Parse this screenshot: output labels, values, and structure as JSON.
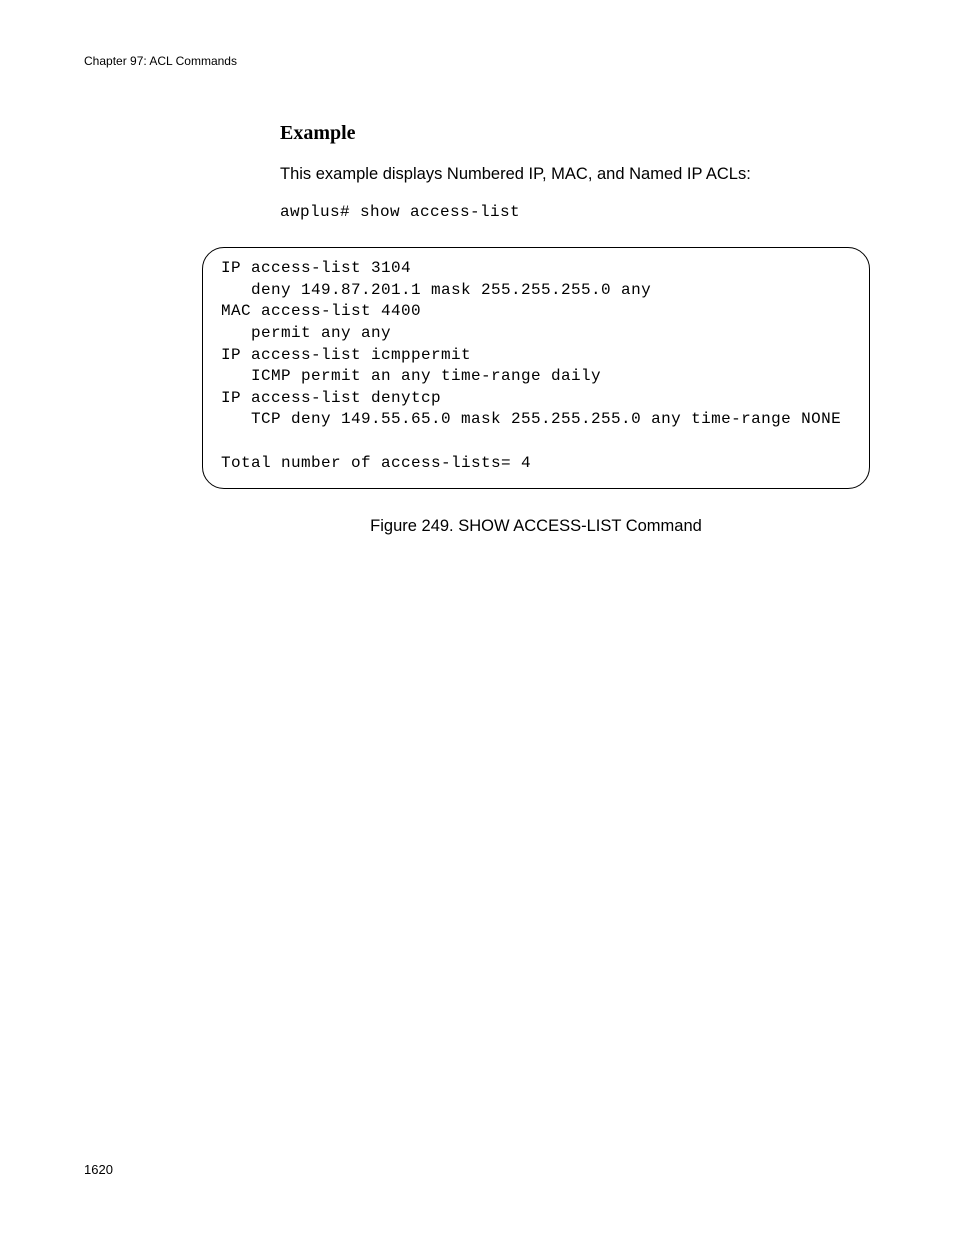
{
  "header": {
    "running_head": "Chapter 97: ACL Commands"
  },
  "section": {
    "heading": "Example",
    "intro": "This example displays Numbered IP, MAC, and Named IP ACLs:",
    "command": "awplus# show access-list"
  },
  "terminal": {
    "output": "IP access-list 3104\n   deny 149.87.201.1 mask 255.255.255.0 any\nMAC access-list 4400\n   permit any any\nIP access-list icmppermit\n   ICMP permit an any time-range daily\nIP access-list denytcp\n   TCP deny 149.55.65.0 mask 255.255.255.0 any time-range NONE\n\nTotal number of access-lists= 4"
  },
  "figure": {
    "caption": "Figure 249. SHOW ACCESS-LIST Command"
  },
  "footer": {
    "page_number": "1620"
  }
}
